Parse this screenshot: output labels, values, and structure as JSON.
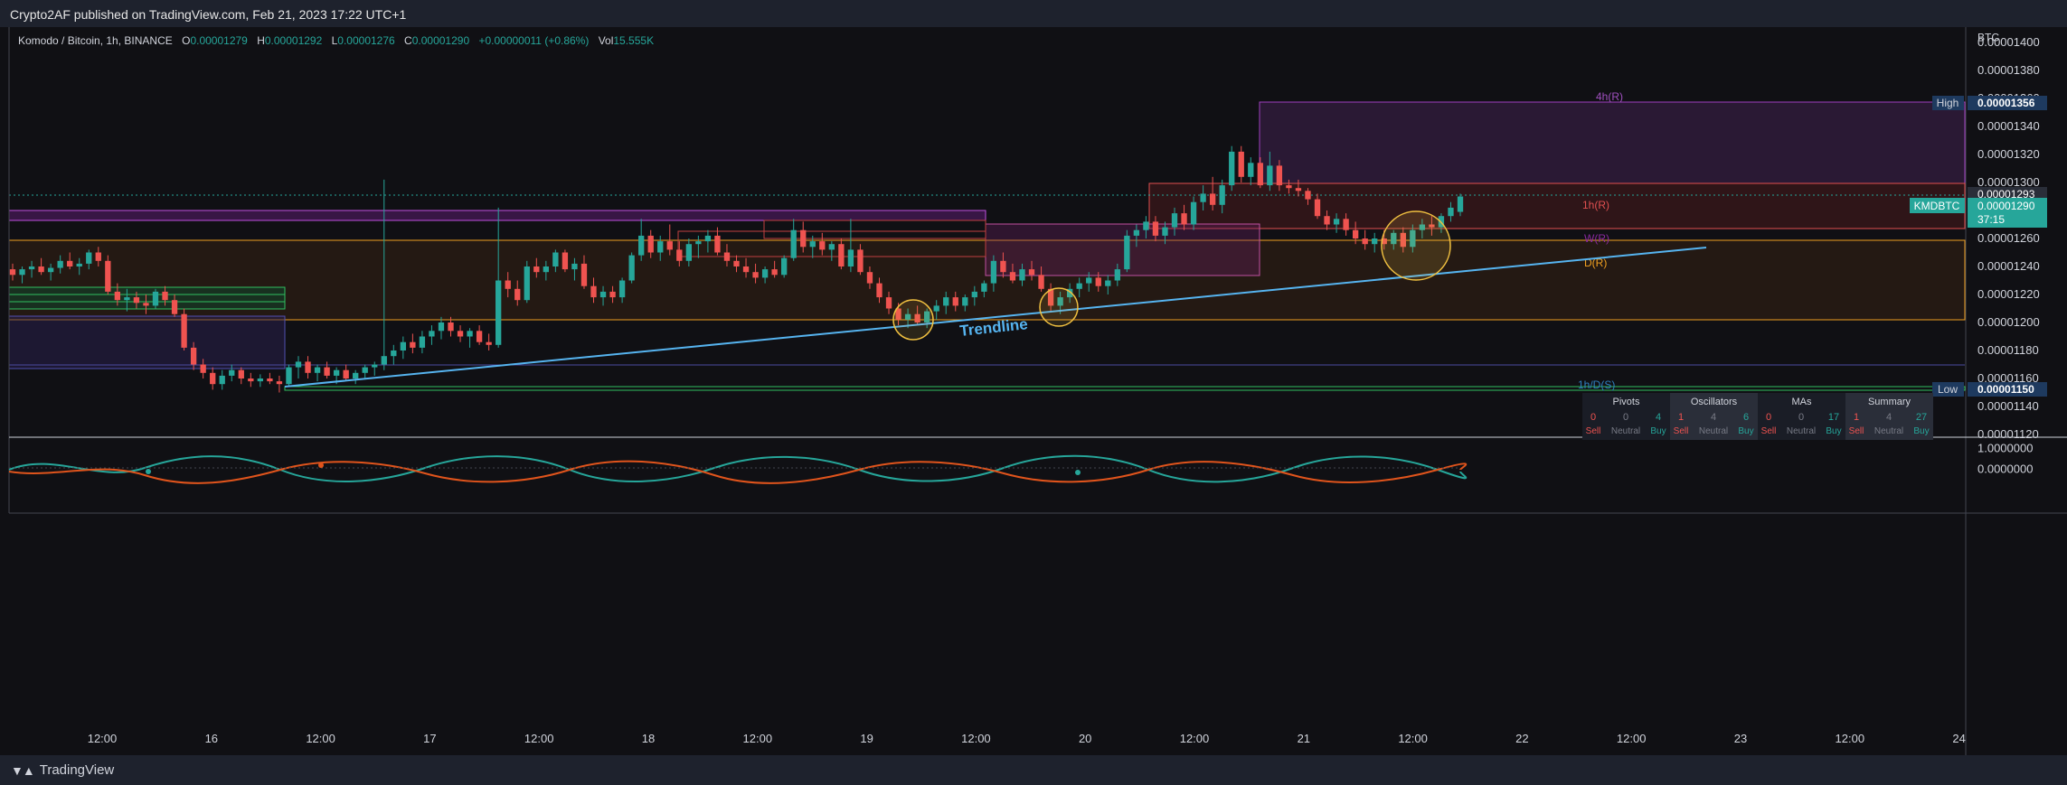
{
  "header": {
    "published": "Crypto2AF published on TradingView.com, Feb 21, 2023 17:22 UTC+1"
  },
  "footer": {
    "brand": "TradingView"
  },
  "legend": {
    "symbol": "Komodo / Bitcoin, 1h, BINANCE",
    "o_label": "O",
    "o": "0.00001279",
    "h_label": "H",
    "h": "0.00001292",
    "l_label": "L",
    "l": "0.00001276",
    "c_label": "C",
    "c": "0.00001290",
    "change": "+0.00000011 (+0.86%)",
    "vol_label": "Vol",
    "vol": "15.555K"
  },
  "tech_table": {
    "headers": [
      "Pivots",
      "Oscillators",
      "MAs",
      "Summary"
    ],
    "counts": [
      "0",
      "0",
      "4",
      "1",
      "4",
      "6",
      "0",
      "0",
      "17",
      "1",
      "4",
      "27"
    ],
    "labels": [
      "Sell",
      "Neutral",
      "Buy",
      "Sell",
      "Neutral",
      "Buy",
      "Sell",
      "Neutral",
      "Buy",
      "Sell",
      "Neutral",
      "Buy"
    ]
  },
  "chart_data": {
    "type": "candlestick",
    "currency_label": "BTC",
    "y_ticks": [
      "0.00001400",
      "0.00001380",
      "0.00001360",
      "0.00001340",
      "0.00001320",
      "0.00001300",
      "0.00001280",
      "0.00001260",
      "0.00001240",
      "0.00001220",
      "0.00001200",
      "0.00001180",
      "0.00001160",
      "0.00001140",
      "0.00001120"
    ],
    "x_ticks": [
      "12:00",
      "16",
      "12:00",
      "17",
      "12:00",
      "18",
      "12:00",
      "19",
      "12:00",
      "20",
      "12:00",
      "21",
      "12:00",
      "22",
      "12:00",
      "23",
      "12:00",
      "24"
    ],
    "price_markers": {
      "high_label": "High",
      "high": "0.00001356",
      "low_label": "Low",
      "low": "0.00001150",
      "marker_1293": "0.00001293",
      "ticker": "KMDBTC",
      "last": "0.00001290",
      "countdown": "37:15"
    },
    "zone_labels": {
      "h4": "4h(R)",
      "h1": "1h(R)",
      "w": "W(R)",
      "d": "D(R)",
      "sup": "1h/D(S)"
    },
    "annotation": "Trendline",
    "candles": [
      [
        1.238e-05,
        1.242e-05,
        1.23e-05,
        1.234e-05
      ],
      [
        1.234e-05,
        1.24e-05,
        1.228e-05,
        1.238e-05
      ],
      [
        1.238e-05,
        1.244e-05,
        1.232e-05,
        1.24e-05
      ],
      [
        1.24e-05,
        1.246e-05,
        1.234e-05,
        1.236e-05
      ],
      [
        1.236e-05,
        1.242e-05,
        1.23e-05,
        1.239e-05
      ],
      [
        1.239e-05,
        1.248e-05,
        1.235e-05,
        1.244e-05
      ],
      [
        1.244e-05,
        1.25e-05,
        1.238e-05,
        1.24e-05
      ],
      [
        1.24e-05,
        1.246e-05,
        1.234e-05,
        1.242e-05
      ],
      [
        1.242e-05,
        1.252e-05,
        1.238e-05,
        1.25e-05
      ],
      [
        1.25e-05,
        1.254e-05,
        1.24e-05,
        1.244e-05
      ],
      [
        1.244e-05,
        1.248e-05,
        1.22e-05,
        1.222e-05
      ],
      [
        1.222e-05,
        1.228e-05,
        1.212e-05,
        1.216e-05
      ],
      [
        1.216e-05,
        1.224e-05,
        1.208e-05,
        1.218e-05
      ],
      [
        1.218e-05,
        1.222e-05,
        1.21e-05,
        1.214e-05
      ],
      [
        1.214e-05,
        1.22e-05,
        1.206e-05,
        1.212e-05
      ],
      [
        1.212e-05,
        1.224e-05,
        1.21e-05,
        1.222e-05
      ],
      [
        1.222e-05,
        1.226e-05,
        1.212e-05,
        1.216e-05
      ],
      [
        1.216e-05,
        1.22e-05,
        1.204e-05,
        1.206e-05
      ],
      [
        1.206e-05,
        1.21e-05,
        1.18e-05,
        1.182e-05
      ],
      [
        1.182e-05,
        1.186e-05,
        1.166e-05,
        1.17e-05
      ],
      [
        1.17e-05,
        1.174e-05,
        1.16e-05,
        1.164e-05
      ],
      [
        1.164e-05,
        1.168e-05,
        1.152e-05,
        1.156e-05
      ],
      [
        1.156e-05,
        1.166e-05,
        1.152e-05,
        1.162e-05
      ],
      [
        1.162e-05,
        1.17e-05,
        1.158e-05,
        1.166e-05
      ],
      [
        1.166e-05,
        1.168e-05,
        1.156e-05,
        1.16e-05
      ],
      [
        1.16e-05,
        1.164e-05,
        1.154e-05,
        1.158e-05
      ],
      [
        1.158e-05,
        1.163e-05,
        1.154e-05,
        1.16e-05
      ],
      [
        1.16e-05,
        1.164e-05,
        1.156e-05,
        1.158e-05
      ],
      [
        1.158e-05,
        1.162e-05,
        1.15e-05,
        1.156e-05
      ],
      [
        1.156e-05,
        1.17e-05,
        1.154e-05,
        1.168e-05
      ],
      [
        1.168e-05,
        1.176e-05,
        1.16e-05,
        1.172e-05
      ],
      [
        1.172e-05,
        1.176e-05,
        1.16e-05,
        1.164e-05
      ],
      [
        1.164e-05,
        1.17e-05,
        1.158e-05,
        1.168e-05
      ],
      [
        1.168e-05,
        1.172e-05,
        1.16e-05,
        1.162e-05
      ],
      [
        1.162e-05,
        1.168e-05,
        1.156e-05,
        1.166e-05
      ],
      [
        1.166e-05,
        1.17e-05,
        1.158e-05,
        1.16e-05
      ],
      [
        1.16e-05,
        1.166e-05,
        1.156e-05,
        1.164e-05
      ],
      [
        1.164e-05,
        1.17e-05,
        1.16e-05,
        1.168e-05
      ],
      [
        1.168e-05,
        1.172e-05,
        1.162e-05,
        1.17e-05
      ],
      [
        1.17e-05,
        1.302e-05,
        1.166e-05,
        1.176e-05
      ],
      [
        1.176e-05,
        1.184e-05,
        1.17e-05,
        1.18e-05
      ],
      [
        1.18e-05,
        1.19e-05,
        1.174e-05,
        1.186e-05
      ],
      [
        1.186e-05,
        1.192e-05,
        1.178e-05,
        1.182e-05
      ],
      [
        1.182e-05,
        1.194e-05,
        1.178e-05,
        1.19e-05
      ],
      [
        1.19e-05,
        1.198e-05,
        1.184e-05,
        1.194e-05
      ],
      [
        1.194e-05,
        1.204e-05,
        1.188e-05,
        1.2e-05
      ],
      [
        1.2e-05,
        1.204e-05,
        1.19e-05,
        1.194e-05
      ],
      [
        1.194e-05,
        1.198e-05,
        1.186e-05,
        1.19e-05
      ],
      [
        1.19e-05,
        1.196e-05,
        1.182e-05,
        1.194e-05
      ],
      [
        1.194e-05,
        1.198e-05,
        1.184e-05,
        1.186e-05
      ],
      [
        1.186e-05,
        1.192e-05,
        1.18e-05,
        1.184e-05
      ],
      [
        1.184e-05,
        1.282e-05,
        1.182e-05,
        1.23e-05
      ],
      [
        1.23e-05,
        1.236e-05,
        1.218e-05,
        1.224e-05
      ],
      [
        1.224e-05,
        1.23e-05,
        1.212e-05,
        1.216e-05
      ],
      [
        1.216e-05,
        1.244e-05,
        1.214e-05,
        1.24e-05
      ],
      [
        1.24e-05,
        1.246e-05,
        1.232e-05,
        1.236e-05
      ],
      [
        1.236e-05,
        1.244e-05,
        1.23e-05,
        1.24e-05
      ],
      [
        1.24e-05,
        1.252e-05,
        1.236e-05,
        1.25e-05
      ],
      [
        1.25e-05,
        1.252e-05,
        1.236e-05,
        1.238e-05
      ],
      [
        1.238e-05,
        1.246e-05,
        1.23e-05,
        1.242e-05
      ],
      [
        1.242e-05,
        1.248e-05,
        1.224e-05,
        1.226e-05
      ],
      [
        1.226e-05,
        1.232e-05,
        1.214e-05,
        1.218e-05
      ],
      [
        1.218e-05,
        1.226e-05,
        1.212e-05,
        1.222e-05
      ],
      [
        1.222e-05,
        1.226e-05,
        1.214e-05,
        1.218e-05
      ],
      [
        1.218e-05,
        1.232e-05,
        1.214e-05,
        1.23e-05
      ],
      [
        1.23e-05,
        1.25e-05,
        1.228e-05,
        1.248e-05
      ],
      [
        1.248e-05,
        1.274e-05,
        1.244e-05,
        1.262e-05
      ],
      [
        1.262e-05,
        1.266e-05,
        1.246e-05,
        1.25e-05
      ],
      [
        1.25e-05,
        1.262e-05,
        1.244e-05,
        1.258e-05
      ],
      [
        1.258e-05,
        1.27e-05,
        1.248e-05,
        1.252e-05
      ],
      [
        1.252e-05,
        1.258e-05,
        1.24e-05,
        1.244e-05
      ],
      [
        1.244e-05,
        1.26e-05,
        1.24e-05,
        1.256e-05
      ],
      [
        1.256e-05,
        1.262e-05,
        1.246e-05,
        1.258e-05
      ],
      [
        1.258e-05,
        1.266e-05,
        1.25e-05,
        1.262e-05
      ],
      [
        1.262e-05,
        1.268e-05,
        1.248e-05,
        1.25e-05
      ],
      [
        1.25e-05,
        1.256e-05,
        1.24e-05,
        1.244e-05
      ],
      [
        1.244e-05,
        1.248e-05,
        1.236e-05,
        1.24e-05
      ],
      [
        1.24e-05,
        1.246e-05,
        1.232e-05,
        1.236e-05
      ],
      [
        1.236e-05,
        1.242e-05,
        1.228e-05,
        1.232e-05
      ],
      [
        1.232e-05,
        1.24e-05,
        1.228e-05,
        1.238e-05
      ],
      [
        1.238e-05,
        1.244e-05,
        1.232e-05,
        1.234e-05
      ],
      [
        1.234e-05,
        1.248e-05,
        1.232e-05,
        1.246e-05
      ],
      [
        1.246e-05,
        1.274e-05,
        1.244e-05,
        1.266e-05
      ],
      [
        1.266e-05,
        1.272e-05,
        1.25e-05,
        1.254e-05
      ],
      [
        1.254e-05,
        1.262e-05,
        1.246e-05,
        1.258e-05
      ],
      [
        1.258e-05,
        1.264e-05,
        1.248e-05,
        1.252e-05
      ],
      [
        1.252e-05,
        1.258e-05,
        1.244e-05,
        1.256e-05
      ],
      [
        1.256e-05,
        1.26e-05,
        1.238e-05,
        1.24e-05
      ],
      [
        1.24e-05,
        1.274e-05,
        1.236e-05,
        1.252e-05
      ],
      [
        1.252e-05,
        1.256e-05,
        1.234e-05,
        1.236e-05
      ],
      [
        1.236e-05,
        1.24e-05,
        1.224e-05,
        1.228e-05
      ],
      [
        1.228e-05,
        1.232e-05,
        1.214e-05,
        1.218e-05
      ],
      [
        1.218e-05,
        1.222e-05,
        1.206e-05,
        1.21e-05
      ],
      [
        1.21e-05,
        1.214e-05,
        1.198e-05,
        1.202e-05
      ],
      [
        1.202e-05,
        1.21e-05,
        1.196e-05,
        1.206e-05
      ],
      [
        1.206e-05,
        1.212e-05,
        1.198e-05,
        1.2e-05
      ],
      [
        1.2e-05,
        1.21e-05,
        1.196e-05,
        1.208e-05
      ],
      [
        1.208e-05,
        1.216e-05,
        1.202e-05,
        1.212e-05
      ],
      [
        1.212e-05,
        1.222e-05,
        1.206e-05,
        1.218e-05
      ],
      [
        1.218e-05,
        1.222e-05,
        1.208e-05,
        1.212e-05
      ],
      [
        1.212e-05,
        1.22e-05,
        1.208e-05,
        1.218e-05
      ],
      [
        1.218e-05,
        1.226e-05,
        1.212e-05,
        1.222e-05
      ],
      [
        1.222e-05,
        1.23e-05,
        1.218e-05,
        1.228e-05
      ],
      [
        1.228e-05,
        1.248e-05,
        1.222e-05,
        1.244e-05
      ],
      [
        1.244e-05,
        1.25e-05,
        1.232e-05,
        1.236e-05
      ],
      [
        1.236e-05,
        1.242e-05,
        1.228e-05,
        1.23e-05
      ],
      [
        1.23e-05,
        1.242e-05,
        1.226e-05,
        1.238e-05
      ],
      [
        1.238e-05,
        1.244e-05,
        1.23e-05,
        1.234e-05
      ],
      [
        1.234e-05,
        1.24e-05,
        1.222e-05,
        1.224e-05
      ],
      [
        1.224e-05,
        1.228e-05,
        1.208e-05,
        1.212e-05
      ],
      [
        1.212e-05,
        1.222e-05,
        1.206e-05,
        1.218e-05
      ],
      [
        1.218e-05,
        1.228e-05,
        1.214e-05,
        1.224e-05
      ],
      [
        1.224e-05,
        1.232e-05,
        1.218e-05,
        1.228e-05
      ],
      [
        1.228e-05,
        1.236e-05,
        1.222e-05,
        1.232e-05
      ],
      [
        1.232e-05,
        1.236e-05,
        1.222e-05,
        1.226e-05
      ],
      [
        1.226e-05,
        1.234e-05,
        1.22e-05,
        1.23e-05
      ],
      [
        1.23e-05,
        1.242e-05,
        1.226e-05,
        1.238e-05
      ],
      [
        1.238e-05,
        1.266e-05,
        1.236e-05,
        1.262e-05
      ],
      [
        1.262e-05,
        1.27e-05,
        1.254e-05,
        1.266e-05
      ],
      [
        1.266e-05,
        1.276e-05,
        1.26e-05,
        1.272e-05
      ],
      [
        1.272e-05,
        1.276e-05,
        1.258e-05,
        1.262e-05
      ],
      [
        1.262e-05,
        1.272e-05,
        1.256e-05,
        1.268e-05
      ],
      [
        1.268e-05,
        1.282e-05,
        1.262e-05,
        1.278e-05
      ],
      [
        1.278e-05,
        1.284e-05,
        1.266e-05,
        1.27e-05
      ],
      [
        1.27e-05,
        1.29e-05,
        1.266e-05,
        1.286e-05
      ],
      [
        1.286e-05,
        1.298e-05,
        1.28e-05,
        1.292e-05
      ],
      [
        1.292e-05,
        1.304e-05,
        1.28e-05,
        1.284e-05
      ],
      [
        1.284e-05,
        1.302e-05,
        1.278e-05,
        1.298e-05
      ],
      [
        1.298e-05,
        1.326e-05,
        1.294e-05,
        1.322e-05
      ],
      [
        1.322e-05,
        1.326e-05,
        1.3e-05,
        1.304e-05
      ],
      [
        1.304e-05,
        1.318e-05,
        1.298e-05,
        1.314e-05
      ],
      [
        1.314e-05,
        1.318e-05,
        1.296e-05,
        1.298e-05
      ],
      [
        1.298e-05,
        1.322e-05,
        1.294e-05,
        1.312e-05
      ],
      [
        1.312e-05,
        1.316e-05,
        1.294e-05,
        1.298e-05
      ],
      [
        1.298e-05,
        1.302e-05,
        1.292e-05,
        1.296e-05
      ],
      [
        1.296e-05,
        1.302e-05,
        1.29e-05,
        1.294e-05
      ],
      [
        1.294e-05,
        1.296e-05,
        1.284e-05,
        1.288e-05
      ],
      [
        1.288e-05,
        1.292e-05,
        1.274e-05,
        1.276e-05
      ],
      [
        1.276e-05,
        1.28e-05,
        1.266e-05,
        1.27e-05
      ],
      [
        1.27e-05,
        1.278e-05,
        1.264e-05,
        1.274e-05
      ],
      [
        1.274e-05,
        1.278e-05,
        1.262e-05,
        1.266e-05
      ],
      [
        1.266e-05,
        1.272e-05,
        1.256e-05,
        1.26e-05
      ],
      [
        1.26e-05,
        1.266e-05,
        1.252e-05,
        1.256e-05
      ],
      [
        1.256e-05,
        1.264e-05,
        1.25e-05,
        1.26e-05
      ],
      [
        1.26e-05,
        1.266e-05,
        1.252e-05,
        1.256e-05
      ],
      [
        1.256e-05,
        1.266e-05,
        1.252e-05,
        1.264e-05
      ],
      [
        1.264e-05,
        1.268e-05,
        1.25e-05,
        1.254e-05
      ],
      [
        1.254e-05,
        1.27e-05,
        1.25e-05,
        1.266e-05
      ],
      [
        1.266e-05,
        1.274e-05,
        1.26e-05,
        1.27e-05
      ],
      [
        1.27e-05,
        1.276e-05,
        1.262e-05,
        1.268e-05
      ],
      [
        1.268e-05,
        1.278e-05,
        1.264e-05,
        1.276e-05
      ],
      [
        1.276e-05,
        1.286e-05,
        1.272e-05,
        1.282e-05
      ],
      [
        1.279e-05,
        1.292e-05,
        1.276e-05,
        1.29e-05
      ]
    ],
    "oscillator": {
      "ticks": [
        "1.0000000",
        "0.0000000"
      ]
    }
  }
}
